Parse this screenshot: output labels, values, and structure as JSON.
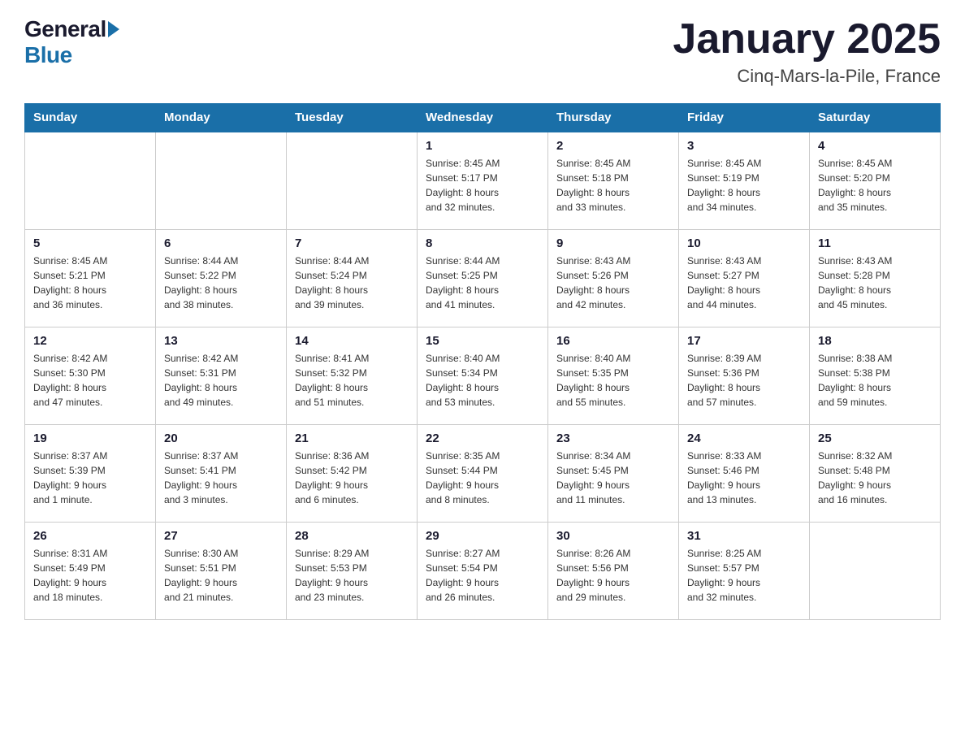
{
  "header": {
    "logo_general": "General",
    "logo_blue": "Blue",
    "title": "January 2025",
    "location": "Cinq-Mars-la-Pile, France"
  },
  "days_of_week": [
    "Sunday",
    "Monday",
    "Tuesday",
    "Wednesday",
    "Thursday",
    "Friday",
    "Saturday"
  ],
  "weeks": [
    [
      {
        "day": "",
        "info": ""
      },
      {
        "day": "",
        "info": ""
      },
      {
        "day": "",
        "info": ""
      },
      {
        "day": "1",
        "info": "Sunrise: 8:45 AM\nSunset: 5:17 PM\nDaylight: 8 hours\nand 32 minutes."
      },
      {
        "day": "2",
        "info": "Sunrise: 8:45 AM\nSunset: 5:18 PM\nDaylight: 8 hours\nand 33 minutes."
      },
      {
        "day": "3",
        "info": "Sunrise: 8:45 AM\nSunset: 5:19 PM\nDaylight: 8 hours\nand 34 minutes."
      },
      {
        "day": "4",
        "info": "Sunrise: 8:45 AM\nSunset: 5:20 PM\nDaylight: 8 hours\nand 35 minutes."
      }
    ],
    [
      {
        "day": "5",
        "info": "Sunrise: 8:45 AM\nSunset: 5:21 PM\nDaylight: 8 hours\nand 36 minutes."
      },
      {
        "day": "6",
        "info": "Sunrise: 8:44 AM\nSunset: 5:22 PM\nDaylight: 8 hours\nand 38 minutes."
      },
      {
        "day": "7",
        "info": "Sunrise: 8:44 AM\nSunset: 5:24 PM\nDaylight: 8 hours\nand 39 minutes."
      },
      {
        "day": "8",
        "info": "Sunrise: 8:44 AM\nSunset: 5:25 PM\nDaylight: 8 hours\nand 41 minutes."
      },
      {
        "day": "9",
        "info": "Sunrise: 8:43 AM\nSunset: 5:26 PM\nDaylight: 8 hours\nand 42 minutes."
      },
      {
        "day": "10",
        "info": "Sunrise: 8:43 AM\nSunset: 5:27 PM\nDaylight: 8 hours\nand 44 minutes."
      },
      {
        "day": "11",
        "info": "Sunrise: 8:43 AM\nSunset: 5:28 PM\nDaylight: 8 hours\nand 45 minutes."
      }
    ],
    [
      {
        "day": "12",
        "info": "Sunrise: 8:42 AM\nSunset: 5:30 PM\nDaylight: 8 hours\nand 47 minutes."
      },
      {
        "day": "13",
        "info": "Sunrise: 8:42 AM\nSunset: 5:31 PM\nDaylight: 8 hours\nand 49 minutes."
      },
      {
        "day": "14",
        "info": "Sunrise: 8:41 AM\nSunset: 5:32 PM\nDaylight: 8 hours\nand 51 minutes."
      },
      {
        "day": "15",
        "info": "Sunrise: 8:40 AM\nSunset: 5:34 PM\nDaylight: 8 hours\nand 53 minutes."
      },
      {
        "day": "16",
        "info": "Sunrise: 8:40 AM\nSunset: 5:35 PM\nDaylight: 8 hours\nand 55 minutes."
      },
      {
        "day": "17",
        "info": "Sunrise: 8:39 AM\nSunset: 5:36 PM\nDaylight: 8 hours\nand 57 minutes."
      },
      {
        "day": "18",
        "info": "Sunrise: 8:38 AM\nSunset: 5:38 PM\nDaylight: 8 hours\nand 59 minutes."
      }
    ],
    [
      {
        "day": "19",
        "info": "Sunrise: 8:37 AM\nSunset: 5:39 PM\nDaylight: 9 hours\nand 1 minute."
      },
      {
        "day": "20",
        "info": "Sunrise: 8:37 AM\nSunset: 5:41 PM\nDaylight: 9 hours\nand 3 minutes."
      },
      {
        "day": "21",
        "info": "Sunrise: 8:36 AM\nSunset: 5:42 PM\nDaylight: 9 hours\nand 6 minutes."
      },
      {
        "day": "22",
        "info": "Sunrise: 8:35 AM\nSunset: 5:44 PM\nDaylight: 9 hours\nand 8 minutes."
      },
      {
        "day": "23",
        "info": "Sunrise: 8:34 AM\nSunset: 5:45 PM\nDaylight: 9 hours\nand 11 minutes."
      },
      {
        "day": "24",
        "info": "Sunrise: 8:33 AM\nSunset: 5:46 PM\nDaylight: 9 hours\nand 13 minutes."
      },
      {
        "day": "25",
        "info": "Sunrise: 8:32 AM\nSunset: 5:48 PM\nDaylight: 9 hours\nand 16 minutes."
      }
    ],
    [
      {
        "day": "26",
        "info": "Sunrise: 8:31 AM\nSunset: 5:49 PM\nDaylight: 9 hours\nand 18 minutes."
      },
      {
        "day": "27",
        "info": "Sunrise: 8:30 AM\nSunset: 5:51 PM\nDaylight: 9 hours\nand 21 minutes."
      },
      {
        "day": "28",
        "info": "Sunrise: 8:29 AM\nSunset: 5:53 PM\nDaylight: 9 hours\nand 23 minutes."
      },
      {
        "day": "29",
        "info": "Sunrise: 8:27 AM\nSunset: 5:54 PM\nDaylight: 9 hours\nand 26 minutes."
      },
      {
        "day": "30",
        "info": "Sunrise: 8:26 AM\nSunset: 5:56 PM\nDaylight: 9 hours\nand 29 minutes."
      },
      {
        "day": "31",
        "info": "Sunrise: 8:25 AM\nSunset: 5:57 PM\nDaylight: 9 hours\nand 32 minutes."
      },
      {
        "day": "",
        "info": ""
      }
    ]
  ]
}
